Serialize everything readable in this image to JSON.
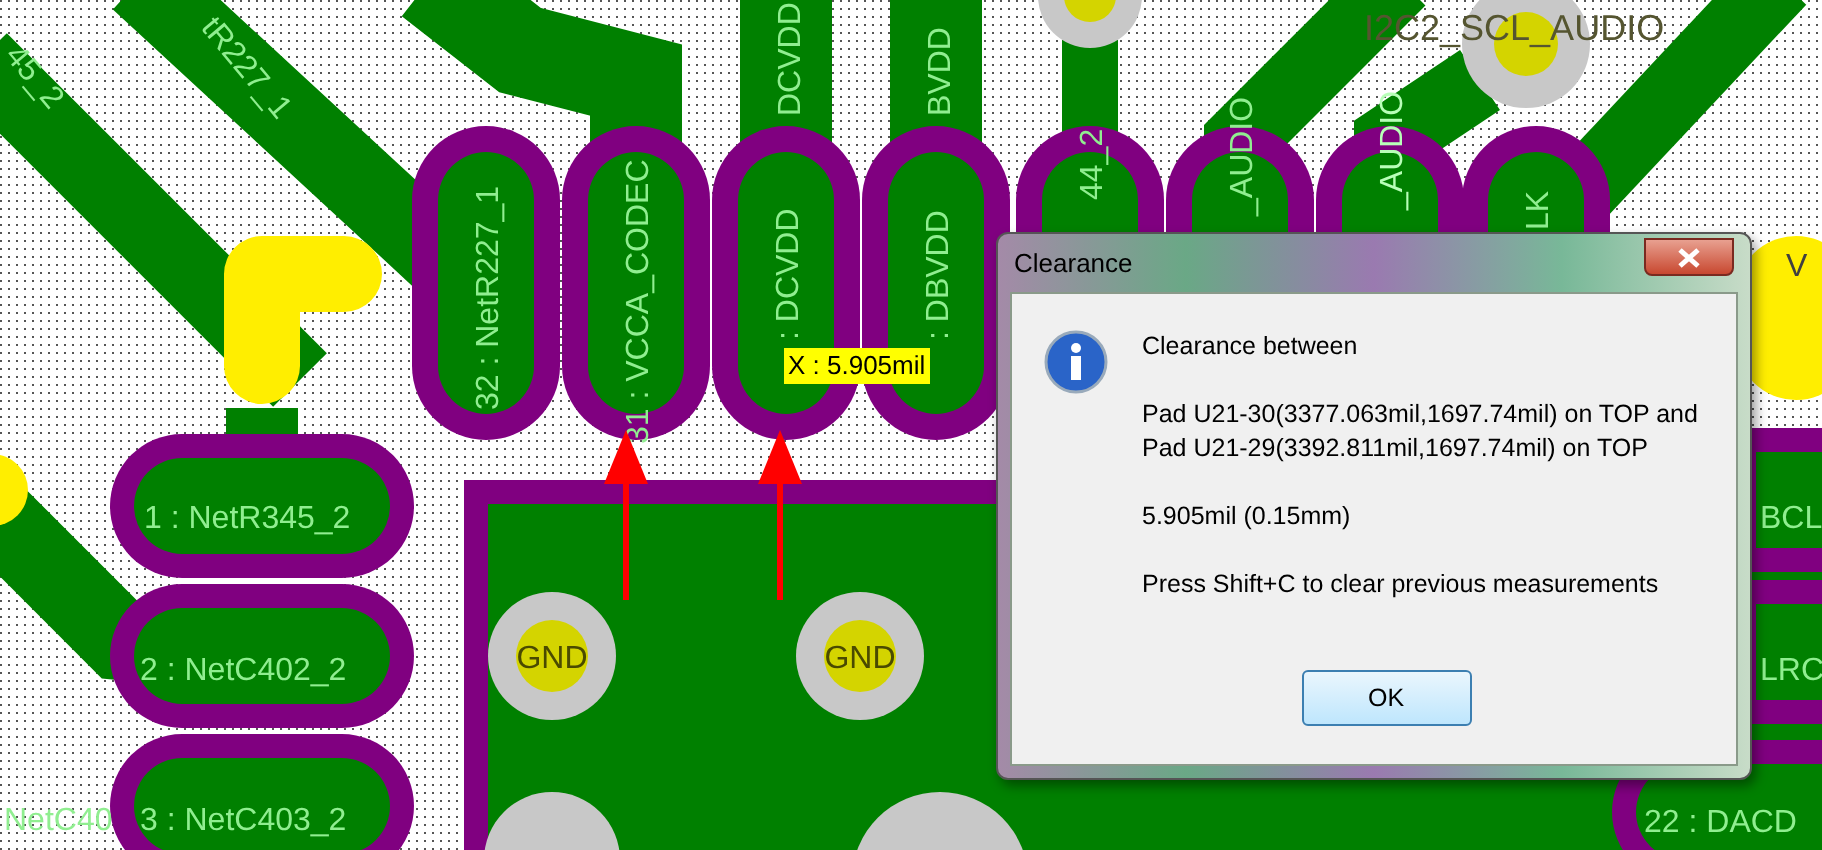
{
  "pcb": {
    "pad_labels": [
      {
        "text": "32 : NetR227_1",
        "kind": "vertical"
      },
      {
        "text": "31 : VCCA_CODEC",
        "kind": "vertical"
      },
      {
        "text": ": DCVDD",
        "kind": "vertical"
      },
      {
        "text": ": DBVDD",
        "kind": "vertical"
      },
      {
        "text": "44_2",
        "kind": "vertical"
      },
      {
        "text": "_AUDIO",
        "kind": "vertical"
      },
      {
        "text": "_AUDIO",
        "kind": "vertical"
      },
      {
        "text": "LK",
        "kind": "vertical"
      },
      {
        "text": "1 : NetR345_2",
        "kind": "horizontal"
      },
      {
        "text": "2 : NetC402_2",
        "kind": "horizontal"
      },
      {
        "text": "NetC40",
        "kind": "horizontal"
      },
      {
        "text": "3 : NetC403_2",
        "kind": "horizontal"
      },
      {
        "text": "BCL",
        "kind": "horizontal"
      },
      {
        "text": "LRC",
        "kind": "horizontal"
      },
      {
        "text": "22 : DACD",
        "kind": "horizontal"
      }
    ],
    "trace_labels": [
      {
        "text": "45_2",
        "kind": "diagonal"
      },
      {
        "text": "tR227_1",
        "kind": "diagonal"
      },
      {
        "text": "DCVDD",
        "kind": "vertical"
      },
      {
        "text": "BVDD",
        "kind": "vertical"
      },
      {
        "text": "V",
        "kind": "horizontal"
      }
    ],
    "net_label": "I2C2_SCL_AUDIO",
    "via_labels": [
      "GND",
      "GND"
    ],
    "measure_tooltip": "X : 5.905mil"
  },
  "dialog": {
    "title": "Clearance",
    "message": [
      "Clearance between",
      "Pad U21-30(3377.063mil,1697.74mil) on TOP and",
      "Pad U21-29(3392.811mil,1697.74mil) on TOP",
      "5.905mil (0.15mm)",
      "Press Shift+C to clear previous measurements"
    ],
    "ok_button": "OK"
  }
}
